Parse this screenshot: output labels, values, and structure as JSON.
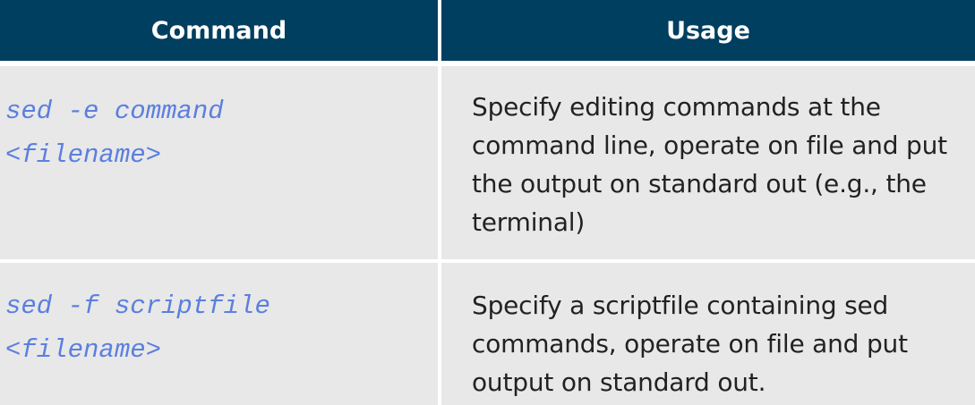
{
  "table": {
    "headers": {
      "command": "Command",
      "usage": "Usage"
    },
    "rows": [
      {
        "command_lines": [
          "sed -e command",
          "<filename>"
        ],
        "usage_lines": [
          "Specify editing commands at the",
          "command line, operate on file and put",
          "the output on standard out (e.g., the",
          "terminal)"
        ]
      },
      {
        "command_lines": [
          "sed -f scriptfile",
          "<filename>"
        ],
        "usage_lines": [
          "Specify a scriptfile containing sed",
          "commands, operate on file and put",
          "output on standard out."
        ]
      }
    ]
  },
  "colors": {
    "header_bg": "#003f5f",
    "cell_bg": "#e8e8e8",
    "code_text": "#5b7fe0"
  }
}
